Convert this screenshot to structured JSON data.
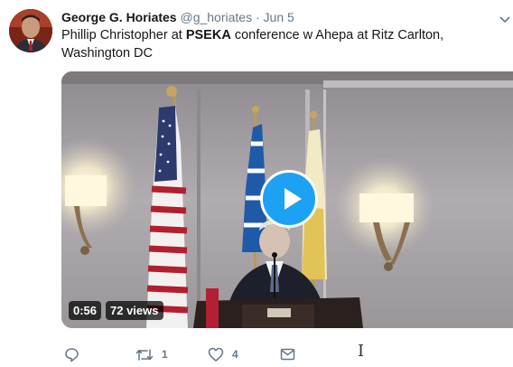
{
  "tweet": {
    "author_name": "George G. Horiates",
    "handle": "@g_horiates",
    "separator": "·",
    "date": "Jun 5",
    "text_before": "Phillip Christopher at ",
    "text_bold": "PSEKA",
    "text_after": " conference w Ahepa at Ritz Carlton, Washington DC"
  },
  "video": {
    "duration": "0:56",
    "views": "72 views"
  },
  "actions": {
    "reply_count": "",
    "retweet_count": "1",
    "like_count": "4"
  },
  "icons": {
    "avatar": "avatar",
    "caret": "chevron-down-icon",
    "play": "play-icon",
    "reply": "reply-icon",
    "retweet": "retweet-icon",
    "like": "heart-icon",
    "message": "envelope-icon",
    "cursor": "text-cursor-icon"
  },
  "colors": {
    "accent": "#1da1f2",
    "secondary_text": "#657786",
    "primary_text": "#14171a"
  }
}
